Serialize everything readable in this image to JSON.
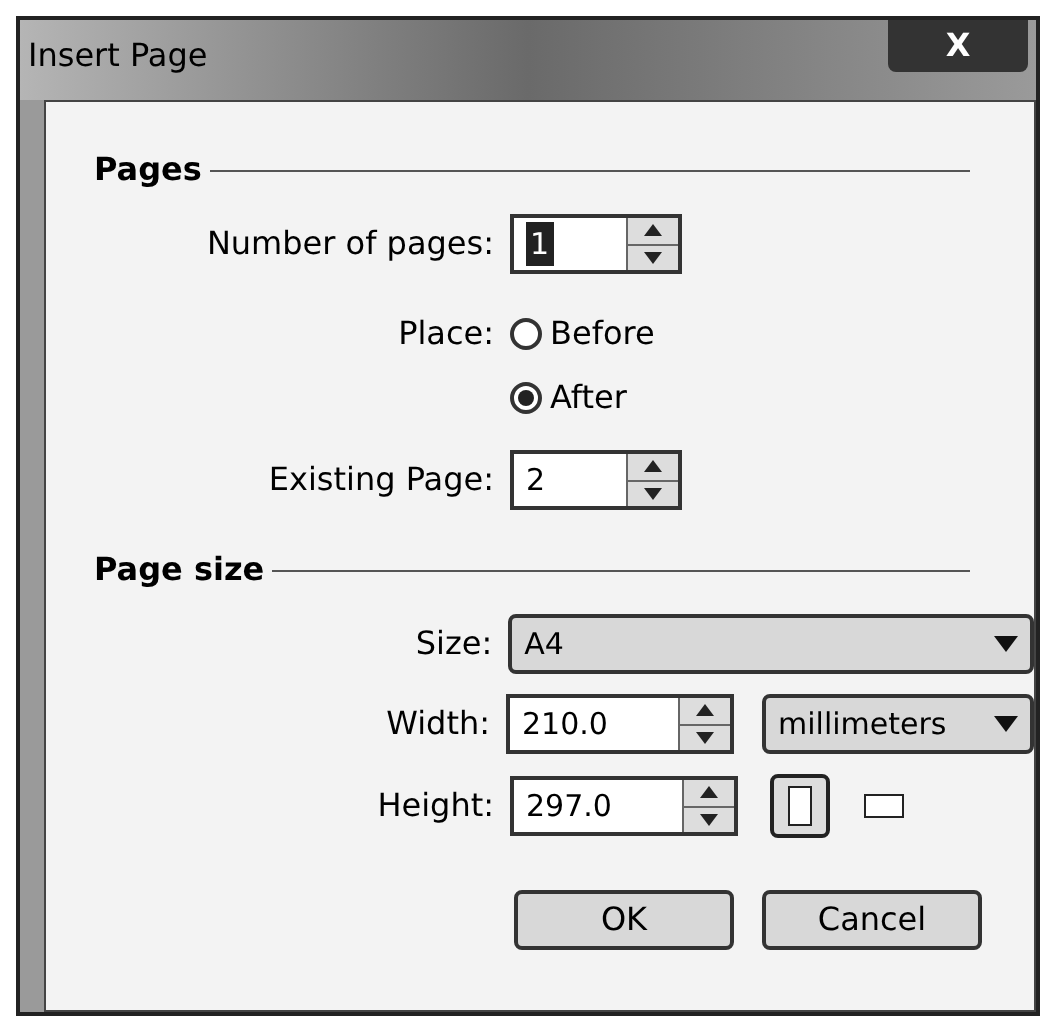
{
  "window": {
    "title": "Insert Page",
    "close": "X"
  },
  "pages": {
    "heading": "Pages",
    "number_of_pages": {
      "label": "Number of pages:",
      "value": "1",
      "selected": true
    },
    "place": {
      "label": "Place:",
      "options": [
        {
          "label": "Before",
          "selected": false
        },
        {
          "label": "After",
          "selected": true
        }
      ]
    },
    "existing_page": {
      "label": "Existing Page:",
      "value": "2"
    }
  },
  "page_size": {
    "heading": "Page size",
    "size": {
      "label": "Size:",
      "value": "A4"
    },
    "width": {
      "label": "Width:",
      "value": "210.0",
      "unit": "millimeters"
    },
    "height": {
      "label": "Height:",
      "value": "297.0"
    },
    "orientation": [
      {
        "kind": "portrait",
        "selected": true
      },
      {
        "kind": "landscape",
        "selected": false
      }
    ]
  },
  "buttons": [
    "OK",
    "Cancel"
  ]
}
